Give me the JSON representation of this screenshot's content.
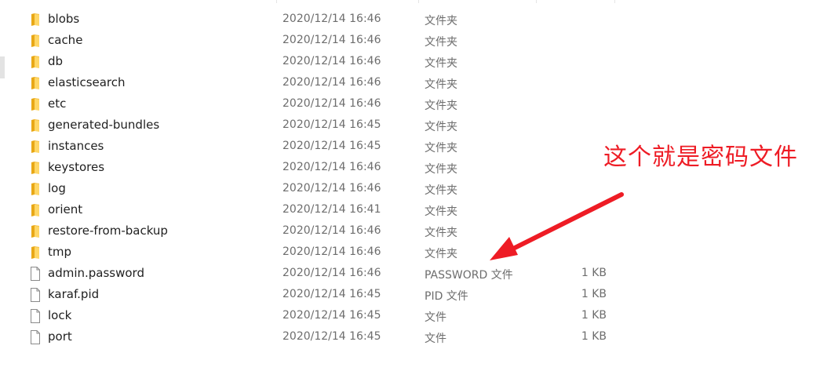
{
  "annotation": {
    "text": "这个就是密码文件",
    "color": "#ee1c25"
  },
  "files": [
    {
      "name": "blobs",
      "date": "2020/12/14 16:46",
      "type": "文件夹",
      "size": "",
      "icon": "folder-icon"
    },
    {
      "name": "cache",
      "date": "2020/12/14 16:46",
      "type": "文件夹",
      "size": "",
      "icon": "folder-icon"
    },
    {
      "name": "db",
      "date": "2020/12/14 16:46",
      "type": "文件夹",
      "size": "",
      "icon": "folder-icon"
    },
    {
      "name": "elasticsearch",
      "date": "2020/12/14 16:46",
      "type": "文件夹",
      "size": "",
      "icon": "folder-icon"
    },
    {
      "name": "etc",
      "date": "2020/12/14 16:46",
      "type": "文件夹",
      "size": "",
      "icon": "folder-icon"
    },
    {
      "name": "generated-bundles",
      "date": "2020/12/14 16:45",
      "type": "文件夹",
      "size": "",
      "icon": "folder-icon"
    },
    {
      "name": "instances",
      "date": "2020/12/14 16:45",
      "type": "文件夹",
      "size": "",
      "icon": "folder-icon"
    },
    {
      "name": "keystores",
      "date": "2020/12/14 16:46",
      "type": "文件夹",
      "size": "",
      "icon": "folder-icon"
    },
    {
      "name": "log",
      "date": "2020/12/14 16:46",
      "type": "文件夹",
      "size": "",
      "icon": "folder-icon"
    },
    {
      "name": "orient",
      "date": "2020/12/14 16:41",
      "type": "文件夹",
      "size": "",
      "icon": "folder-icon"
    },
    {
      "name": "restore-from-backup",
      "date": "2020/12/14 16:46",
      "type": "文件夹",
      "size": "",
      "icon": "folder-icon"
    },
    {
      "name": "tmp",
      "date": "2020/12/14 16:46",
      "type": "文件夹",
      "size": "",
      "icon": "folder-icon"
    },
    {
      "name": "admin.password",
      "date": "2020/12/14 16:46",
      "type": "PASSWORD 文件",
      "size": "1 KB",
      "icon": "file-icon"
    },
    {
      "name": "karaf.pid",
      "date": "2020/12/14 16:45",
      "type": "PID 文件",
      "size": "1 KB",
      "icon": "file-icon"
    },
    {
      "name": "lock",
      "date": "2020/12/14 16:45",
      "type": "文件",
      "size": "1 KB",
      "icon": "file-icon"
    },
    {
      "name": "port",
      "date": "2020/12/14 16:45",
      "type": "文件",
      "size": "1 KB",
      "icon": "file-icon"
    }
  ]
}
